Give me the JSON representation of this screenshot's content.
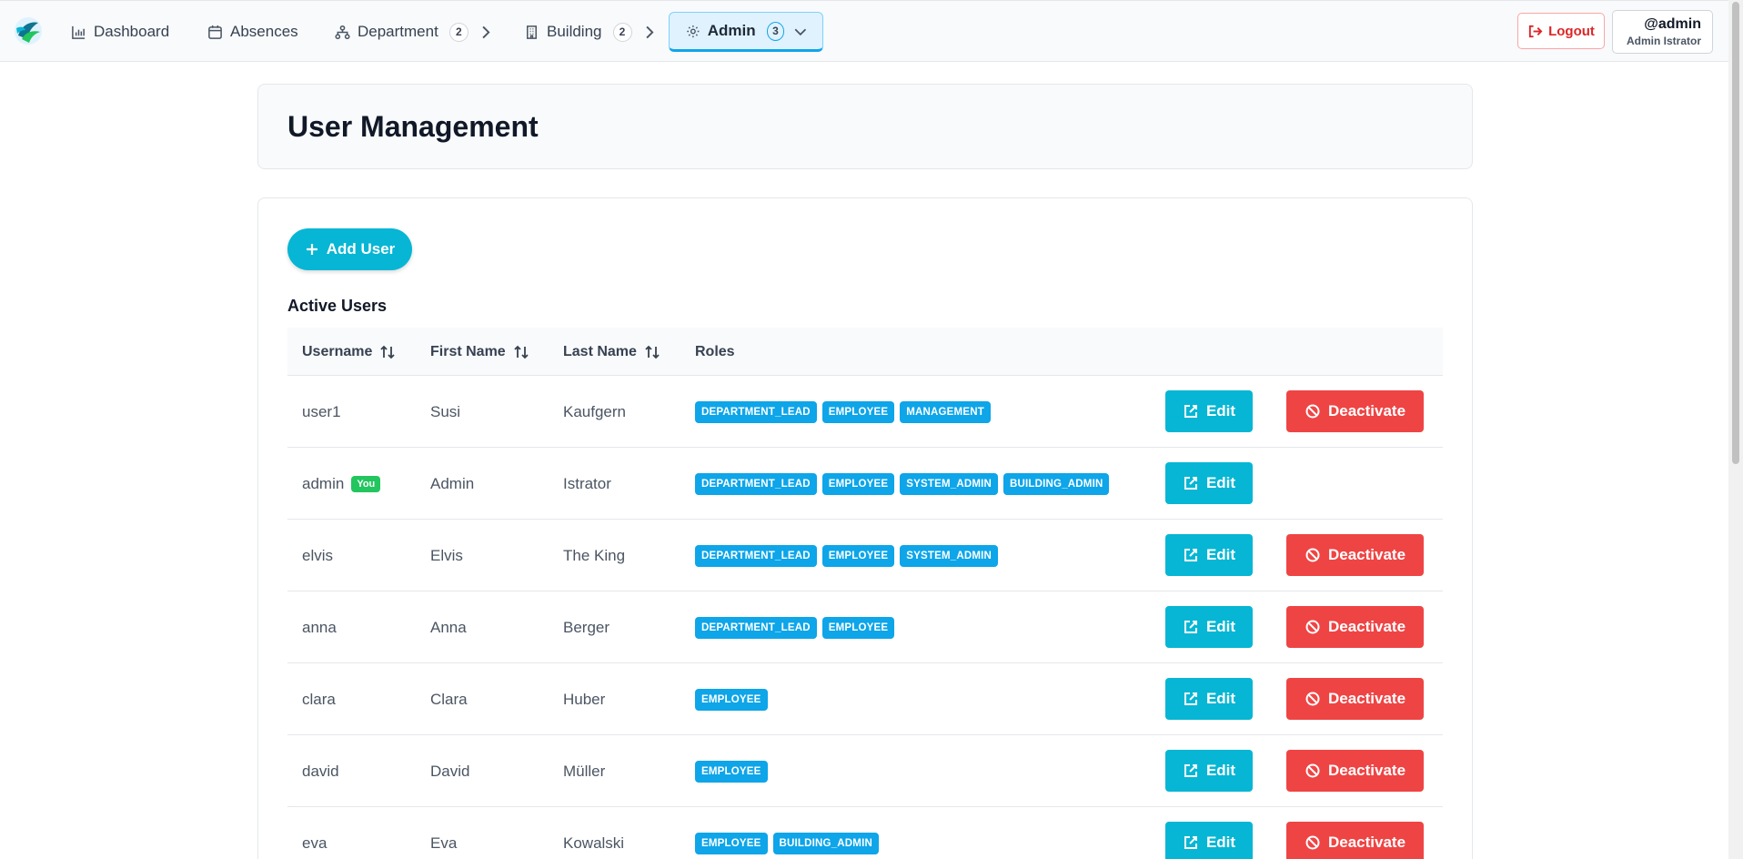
{
  "nav": {
    "items": [
      {
        "label": "Dashboard",
        "icon": "bar-chart-icon"
      },
      {
        "label": "Absences",
        "icon": "calendar-icon"
      },
      {
        "label": "Department",
        "icon": "org-chart-icon",
        "badge": "2"
      },
      {
        "label": "Building",
        "icon": "building-icon",
        "badge": "2"
      },
      {
        "label": "Admin",
        "icon": "gear-icon",
        "badge": "3"
      }
    ],
    "logout_label": "Logout",
    "user_handle": "@admin",
    "user_fullname": "Admin Istrator"
  },
  "page": {
    "title": "User Management",
    "add_label": "Add User",
    "section_title": "Active Users"
  },
  "table": {
    "headers": [
      "Username",
      "First Name",
      "Last Name",
      "Roles"
    ],
    "edit_label": "Edit",
    "deactivate_label": "Deactivate",
    "you_label": "You",
    "rows": [
      {
        "username": "user1",
        "first": "Susi",
        "last": "Kaufgern",
        "roles": [
          "DEPARTMENT_LEAD",
          "EMPLOYEE",
          "MANAGEMENT"
        ],
        "you": false,
        "can_deactivate": true
      },
      {
        "username": "admin",
        "first": "Admin",
        "last": "Istrator",
        "roles": [
          "DEPARTMENT_LEAD",
          "EMPLOYEE",
          "SYSTEM_ADMIN",
          "BUILDING_ADMIN"
        ],
        "you": true,
        "can_deactivate": false
      },
      {
        "username": "elvis",
        "first": "Elvis",
        "last": "The King",
        "roles": [
          "DEPARTMENT_LEAD",
          "EMPLOYEE",
          "SYSTEM_ADMIN"
        ],
        "you": false,
        "can_deactivate": true
      },
      {
        "username": "anna",
        "first": "Anna",
        "last": "Berger",
        "roles": [
          "DEPARTMENT_LEAD",
          "EMPLOYEE"
        ],
        "you": false,
        "can_deactivate": true
      },
      {
        "username": "clara",
        "first": "Clara",
        "last": "Huber",
        "roles": [
          "EMPLOYEE"
        ],
        "you": false,
        "can_deactivate": true
      },
      {
        "username": "david",
        "first": "David",
        "last": "Müller",
        "roles": [
          "EMPLOYEE"
        ],
        "you": false,
        "can_deactivate": true
      },
      {
        "username": "eva",
        "first": "Eva",
        "last": "Kowalski",
        "roles": [
          "EMPLOYEE",
          "BUILDING_ADMIN"
        ],
        "you": false,
        "can_deactivate": true
      }
    ]
  },
  "colors": {
    "accent": "#06b6d4",
    "role_badge": "#0ea5e9",
    "danger": "#ef4444",
    "you_badge": "#22c55e"
  }
}
